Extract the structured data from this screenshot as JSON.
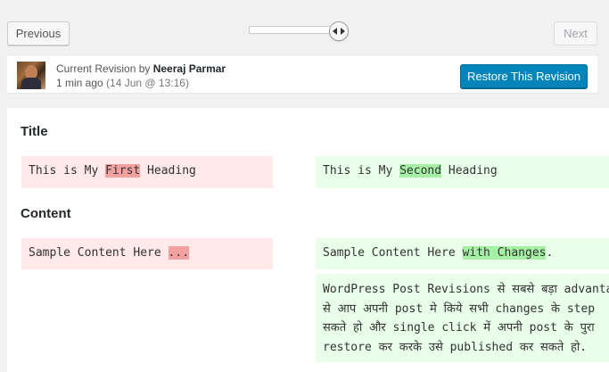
{
  "nav": {
    "previous_label": "Previous",
    "next_label": "Next",
    "slider_value": 1.0
  },
  "meta": {
    "byline_prefix": "Current Revision by",
    "author": "Neeraj Parmar",
    "relative_time": "1 min ago",
    "timestamp": "(14 Jun @ 13:16)",
    "restore_label": "Restore This Revision"
  },
  "diff": {
    "title_heading": "Title",
    "title_old": {
      "before": "This is My ",
      "changed": "First",
      "after": " Heading"
    },
    "title_new": {
      "before": "This is My ",
      "changed": "Second",
      "after": " Heading"
    },
    "content_heading": "Content",
    "content_old": {
      "before": "Sample Content Here ",
      "changed": "...",
      "after": ""
    },
    "content_new": {
      "before": "Sample Content Here ",
      "changed": "with Changes",
      "after": "."
    },
    "added_paragraph": [
      "WordPress Post Revisions से सबसे बड़ा advanta",
      "से आप अपनी post मे किये सभी changes के step",
      "सकते हो और single click में अपनी post के पुरा",
      "restore कर करके उसे published कर सकते हो."
    ]
  },
  "colors": {
    "primary_button": "#0085ba",
    "deleted_bg": "#ffe9e9",
    "deleted_highlight": "#f3a0a0",
    "inserted_bg": "#e9ffe9",
    "inserted_highlight": "#a6f0a6"
  }
}
